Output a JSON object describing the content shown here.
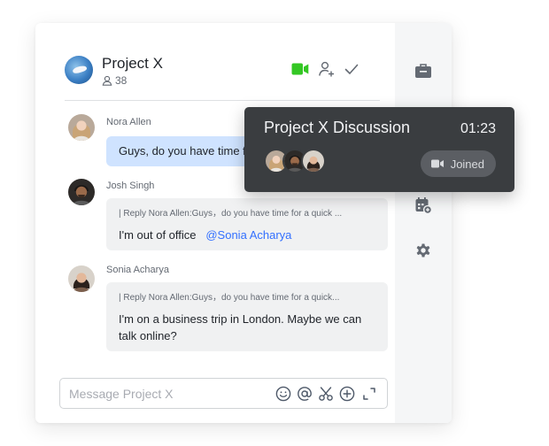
{
  "chat": {
    "title": "Project X",
    "member_count": "38",
    "icons": [
      "video-call-icon",
      "add-member-icon",
      "checkmark-icon"
    ],
    "accent_color": "#34c724"
  },
  "messages": [
    {
      "sender": "Nora Allen",
      "text": "Guys, do you have time f",
      "is_self_style": true
    },
    {
      "sender": "Josh Singh",
      "reply": "| Reply Nora Allen:Guys，do you have time for a quick ...",
      "text": "I'm out of office",
      "mention": "@Sonia Acharya"
    },
    {
      "sender": "Sonia Acharya",
      "reply": "| Reply Nora Allen:Guys，do you have time for a quick...",
      "text": "I'm on a business trip in London. Maybe we can talk online?"
    }
  ],
  "composer": {
    "placeholder": "Message Project X",
    "tools": [
      "emoji-icon",
      "mention-icon",
      "scissors-icon",
      "plus-circle-icon",
      "expand-icon"
    ]
  },
  "sidebar": {
    "icons": [
      "briefcase-icon",
      "calendar-add-icon",
      "settings-icon"
    ]
  },
  "call": {
    "title": "Project X Discussion",
    "timer": "01:23",
    "joined_label": "Joined",
    "participants": [
      "Nora Allen",
      "Josh Singh",
      "Sonia Acharya"
    ]
  }
}
